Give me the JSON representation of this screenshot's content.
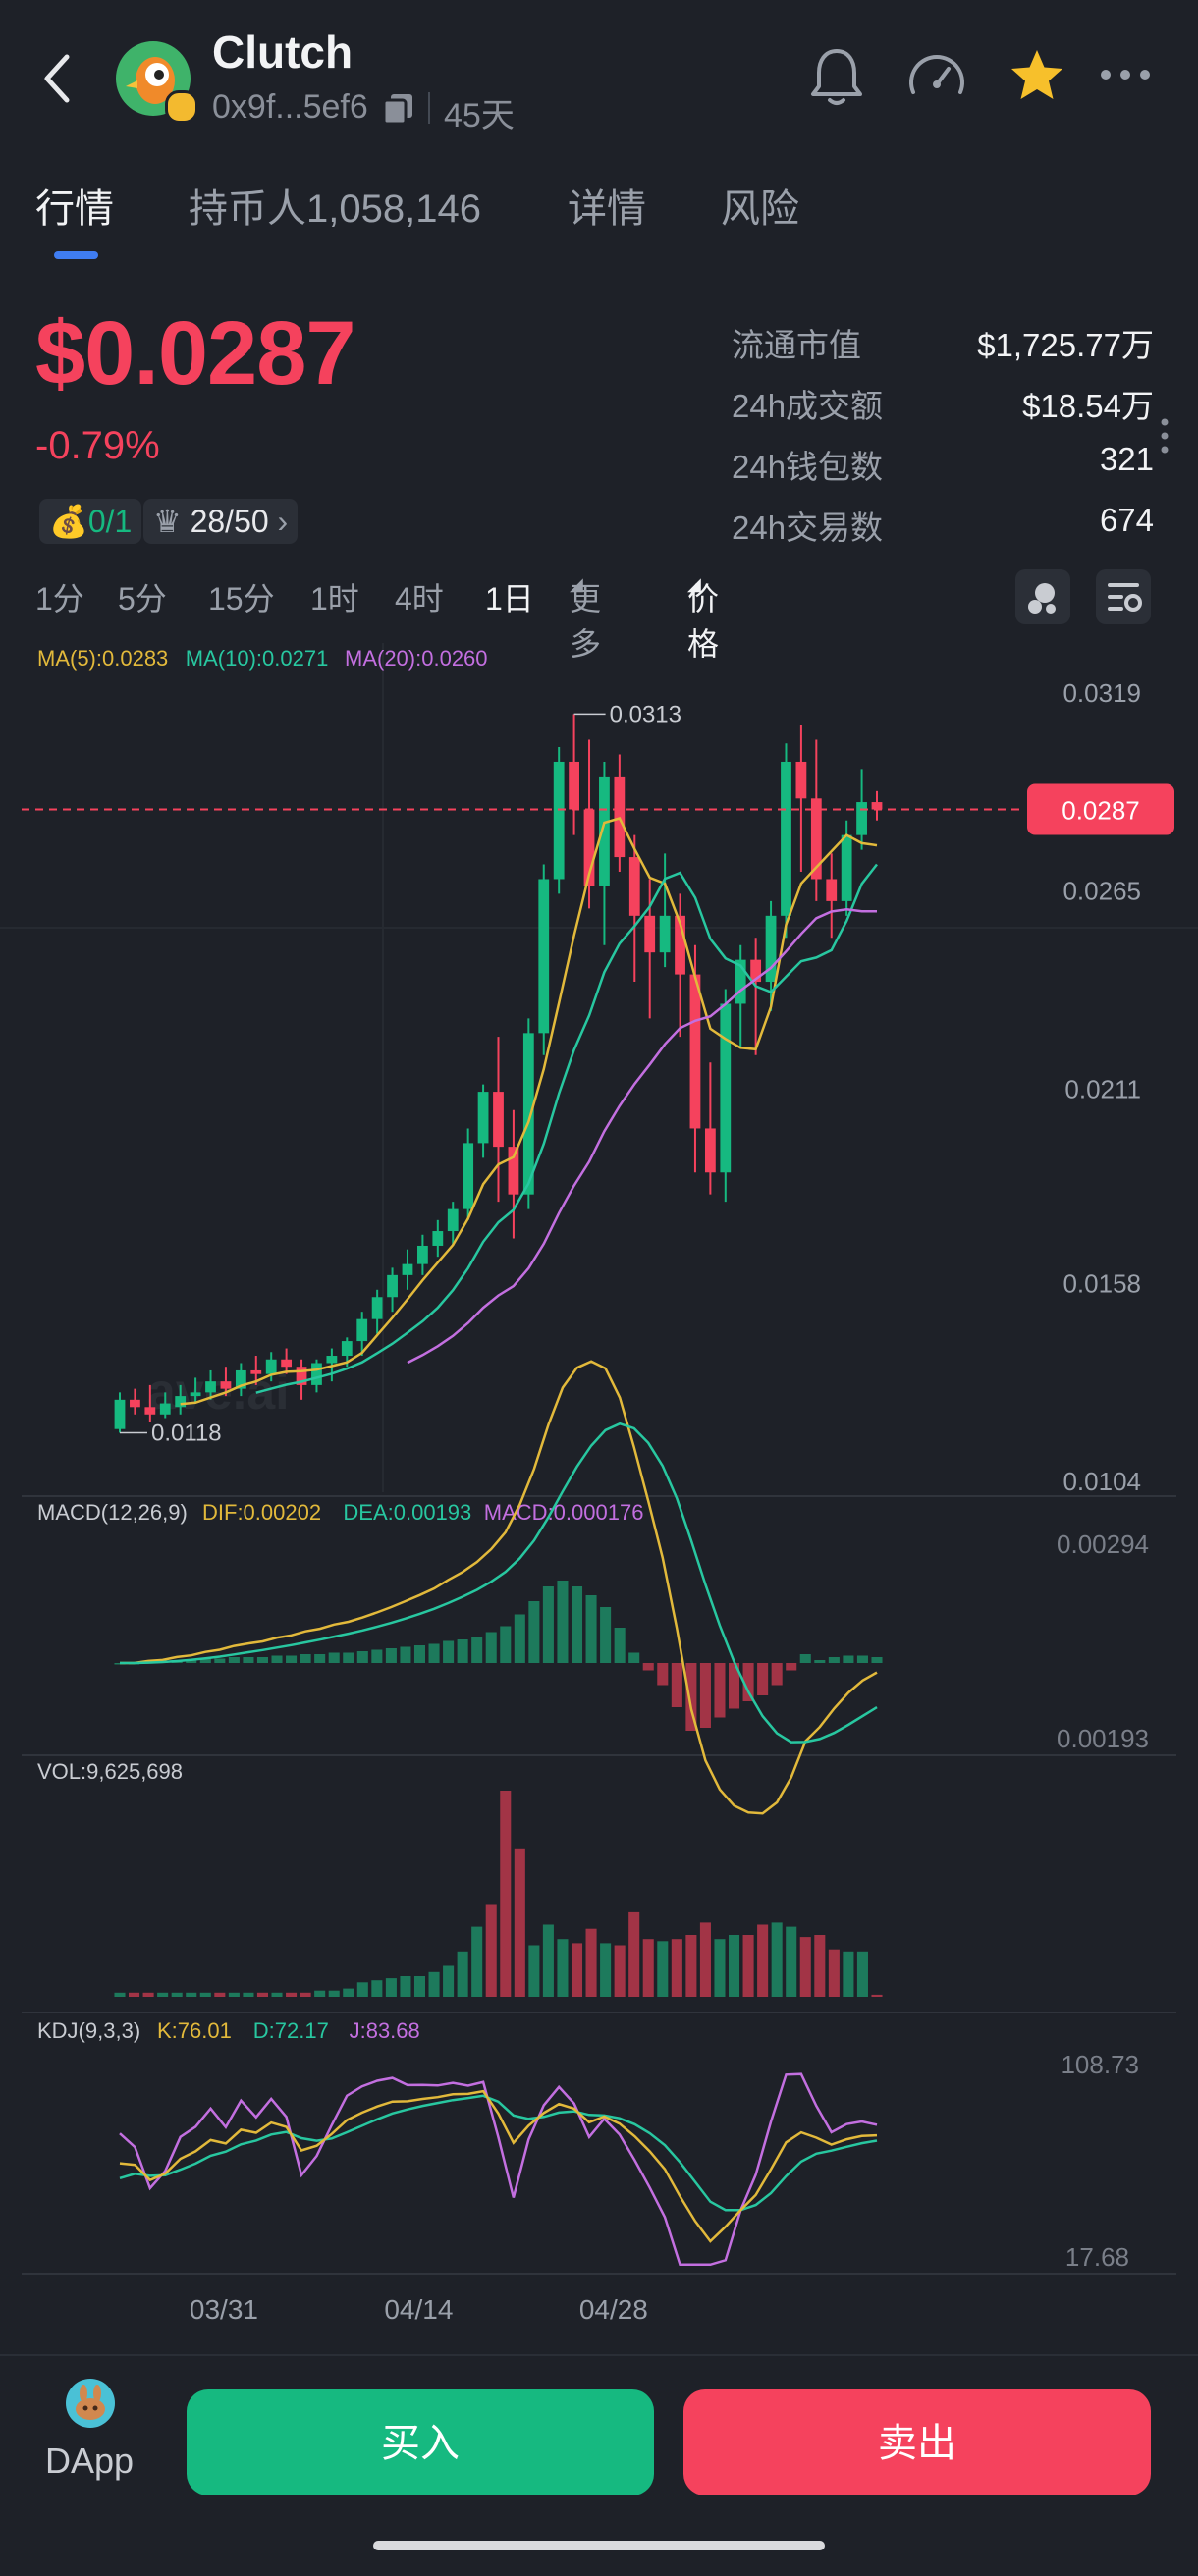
{
  "header": {
    "title": "Clutch",
    "address": "0x9f...5ef6",
    "age": "45天"
  },
  "tabs": [
    {
      "label": "行情",
      "active": true
    },
    {
      "label": "持币人1,058,146",
      "active": false
    },
    {
      "label": "详情",
      "active": false
    },
    {
      "label": "风险",
      "active": false
    }
  ],
  "price": {
    "value": "$0.0287",
    "change": "-0.79%",
    "up_color": "#16b980",
    "down_color": "#f5425d"
  },
  "badges": {
    "bag": "0/1",
    "crown": "28/50"
  },
  "stats": [
    {
      "label": "流通市值",
      "value": "$1,725.77万"
    },
    {
      "label": "24h成交额",
      "value": "$18.54万"
    },
    {
      "label": "24h钱包数",
      "value": "321"
    },
    {
      "label": "24h交易数",
      "value": "674"
    }
  ],
  "periods": [
    {
      "label": "1分",
      "active": false
    },
    {
      "label": "5分",
      "active": false
    },
    {
      "label": "15分",
      "active": false
    },
    {
      "label": "1时",
      "active": false
    },
    {
      "label": "4时",
      "active": false
    },
    {
      "label": "1日",
      "active": true
    },
    {
      "label": "更多",
      "active": false
    },
    {
      "label": "价格",
      "active": false
    }
  ],
  "chart_data": [
    {
      "type": "candlestick",
      "title": "",
      "ma_legend": [
        {
          "label": "MA(5):0.0283",
          "color": "#e2b93b"
        },
        {
          "label": "MA(10):0.0271",
          "color": "#28c7a0"
        },
        {
          "label": "MA(20):0.0260",
          "color": "#c36fe0"
        }
      ],
      "y_ticks": [
        "0.0319",
        "0.0265",
        "0.0211",
        "0.0158",
        "0.0104"
      ],
      "ylim": [
        0.0104,
        0.0319
      ],
      "current_price_label": "0.0287",
      "high_label": "0.0313",
      "low_label": "0.0118",
      "watermark": "ave.ai",
      "x_ticks": [
        "03/31",
        "04/14",
        "04/28"
      ],
      "candles": [
        {
          "o": 0.0118,
          "h": 0.0128,
          "l": 0.0117,
          "c": 0.0126
        },
        {
          "o": 0.0126,
          "h": 0.0129,
          "l": 0.0122,
          "c": 0.0124
        },
        {
          "o": 0.0124,
          "h": 0.013,
          "l": 0.012,
          "c": 0.0122
        },
        {
          "o": 0.0122,
          "h": 0.0128,
          "l": 0.0121,
          "c": 0.0125
        },
        {
          "o": 0.0124,
          "h": 0.013,
          "l": 0.0122,
          "c": 0.0127
        },
        {
          "o": 0.0127,
          "h": 0.0132,
          "l": 0.0125,
          "c": 0.0128
        },
        {
          "o": 0.0128,
          "h": 0.0134,
          "l": 0.0126,
          "c": 0.0131
        },
        {
          "o": 0.0131,
          "h": 0.0135,
          "l": 0.0127,
          "c": 0.0129
        },
        {
          "o": 0.0129,
          "h": 0.0136,
          "l": 0.0127,
          "c": 0.0134
        },
        {
          "o": 0.0134,
          "h": 0.0138,
          "l": 0.013,
          "c": 0.0133
        },
        {
          "o": 0.0133,
          "h": 0.0139,
          "l": 0.0131,
          "c": 0.0137
        },
        {
          "o": 0.0137,
          "h": 0.014,
          "l": 0.0133,
          "c": 0.0135
        },
        {
          "o": 0.0135,
          "h": 0.0137,
          "l": 0.0126,
          "c": 0.013
        },
        {
          "o": 0.013,
          "h": 0.0137,
          "l": 0.0128,
          "c": 0.0136
        },
        {
          "o": 0.0136,
          "h": 0.014,
          "l": 0.0131,
          "c": 0.0138
        },
        {
          "o": 0.0138,
          "h": 0.0143,
          "l": 0.0135,
          "c": 0.0142
        },
        {
          "o": 0.0142,
          "h": 0.015,
          "l": 0.0138,
          "c": 0.0148
        },
        {
          "o": 0.0148,
          "h": 0.0156,
          "l": 0.0144,
          "c": 0.0154
        },
        {
          "o": 0.0154,
          "h": 0.0162,
          "l": 0.015,
          "c": 0.016
        },
        {
          "o": 0.016,
          "h": 0.0167,
          "l": 0.0156,
          "c": 0.0163
        },
        {
          "o": 0.0163,
          "h": 0.0171,
          "l": 0.016,
          "c": 0.0168
        },
        {
          "o": 0.0168,
          "h": 0.0175,
          "l": 0.0165,
          "c": 0.0172
        },
        {
          "o": 0.0172,
          "h": 0.018,
          "l": 0.0168,
          "c": 0.0178
        },
        {
          "o": 0.0178,
          "h": 0.02,
          "l": 0.0175,
          "c": 0.0196
        },
        {
          "o": 0.0196,
          "h": 0.0212,
          "l": 0.0192,
          "c": 0.021
        },
        {
          "o": 0.021,
          "h": 0.0225,
          "l": 0.018,
          "c": 0.0195
        },
        {
          "o": 0.0195,
          "h": 0.0205,
          "l": 0.017,
          "c": 0.0182
        },
        {
          "o": 0.0182,
          "h": 0.023,
          "l": 0.0178,
          "c": 0.0226
        },
        {
          "o": 0.0226,
          "h": 0.0272,
          "l": 0.022,
          "c": 0.0268
        },
        {
          "o": 0.0268,
          "h": 0.0304,
          "l": 0.0264,
          "c": 0.03
        },
        {
          "o": 0.03,
          "h": 0.0313,
          "l": 0.028,
          "c": 0.0287
        },
        {
          "o": 0.0287,
          "h": 0.0306,
          "l": 0.026,
          "c": 0.0266
        },
        {
          "o": 0.0266,
          "h": 0.03,
          "l": 0.025,
          "c": 0.0296
        },
        {
          "o": 0.0296,
          "h": 0.0302,
          "l": 0.027,
          "c": 0.0274
        },
        {
          "o": 0.0274,
          "h": 0.028,
          "l": 0.024,
          "c": 0.0258
        },
        {
          "o": 0.0258,
          "h": 0.0268,
          "l": 0.023,
          "c": 0.0248
        },
        {
          "o": 0.0248,
          "h": 0.0275,
          "l": 0.0244,
          "c": 0.0258
        },
        {
          "o": 0.0258,
          "h": 0.0264,
          "l": 0.0225,
          "c": 0.0242
        },
        {
          "o": 0.0242,
          "h": 0.025,
          "l": 0.0188,
          "c": 0.02
        },
        {
          "o": 0.02,
          "h": 0.0218,
          "l": 0.0182,
          "c": 0.0188
        },
        {
          "o": 0.0188,
          "h": 0.0238,
          "l": 0.018,
          "c": 0.0234
        },
        {
          "o": 0.0234,
          "h": 0.025,
          "l": 0.0222,
          "c": 0.0246
        },
        {
          "o": 0.0246,
          "h": 0.0252,
          "l": 0.022,
          "c": 0.024
        },
        {
          "o": 0.024,
          "h": 0.0262,
          "l": 0.0232,
          "c": 0.0258
        },
        {
          "o": 0.0258,
          "h": 0.0305,
          "l": 0.0252,
          "c": 0.03
        },
        {
          "o": 0.03,
          "h": 0.031,
          "l": 0.027,
          "c": 0.029
        },
        {
          "o": 0.029,
          "h": 0.0306,
          "l": 0.0262,
          "c": 0.0268
        },
        {
          "o": 0.0268,
          "h": 0.0275,
          "l": 0.0252,
          "c": 0.0262
        },
        {
          "o": 0.0262,
          "h": 0.0284,
          "l": 0.0258,
          "c": 0.028
        },
        {
          "o": 0.028,
          "h": 0.0298,
          "l": 0.0276,
          "c": 0.0289
        },
        {
          "o": 0.0289,
          "h": 0.0292,
          "l": 0.0284,
          "c": 0.0287
        }
      ]
    },
    {
      "type": "line",
      "title": "MACD(12,26,9)",
      "legend": [
        {
          "label": "DIF:0.00202",
          "color": "#e2b93b"
        },
        {
          "label": "DEA:0.00193",
          "color": "#28c7a0"
        },
        {
          "label": "MACD:0.000176",
          "color": "#c36fe0"
        }
      ],
      "y_ticks": [
        "0.00294",
        "0.00193"
      ],
      "histogram": [
        0,
        0,
        0.01,
        0.01,
        0.02,
        0.02,
        0.03,
        0.03,
        0.04,
        0.04,
        0.04,
        0.05,
        0.05,
        0.06,
        0.06,
        0.07,
        0.07,
        0.08,
        0.09,
        0.1,
        0.11,
        0.12,
        0.13,
        0.15,
        0.16,
        0.18,
        0.21,
        0.25,
        0.33,
        0.42,
        0.52,
        0.56,
        0.52,
        0.46,
        0.38,
        0.24,
        0.07,
        -0.05,
        -0.15,
        -0.3,
        -0.46,
        -0.44,
        -0.37,
        -0.31,
        -0.26,
        -0.22,
        -0.15,
        -0.05,
        0.06,
        0.02,
        0.04,
        0.05,
        0.05,
        0.04
      ]
    },
    {
      "type": "bar",
      "title": "VOL:9,625,698",
      "values": [
        0.02,
        0.02,
        0.02,
        0.02,
        0.02,
        0.02,
        0.02,
        0.02,
        0.02,
        0.02,
        0.02,
        0.02,
        0.02,
        0.02,
        0.03,
        0.03,
        0.04,
        0.07,
        0.08,
        0.09,
        0.1,
        0.1,
        0.12,
        0.15,
        0.22,
        0.34,
        0.45,
        1.0,
        0.72,
        0.25,
        0.35,
        0.28,
        0.26,
        0.33,
        0.26,
        0.25,
        0.41,
        0.28,
        0.27,
        0.28,
        0.3,
        0.36,
        0.28,
        0.3,
        0.3,
        0.35,
        0.36,
        0.34,
        0.29,
        0.3,
        0.23,
        0.22,
        0.22,
        0.01
      ]
    },
    {
      "type": "line",
      "title": "KDJ(9,3,3)",
      "legend": [
        {
          "label": "K:76.01",
          "color": "#e2b93b"
        },
        {
          "label": "D:72.17",
          "color": "#28c7a0"
        },
        {
          "label": "J:83.68",
          "color": "#c36fe0"
        }
      ],
      "y_ticks": [
        "108.73",
        "17.68"
      ]
    }
  ],
  "bottom": {
    "dapp_label": "DApp",
    "buy_label": "买入",
    "sell_label": "卖出"
  }
}
